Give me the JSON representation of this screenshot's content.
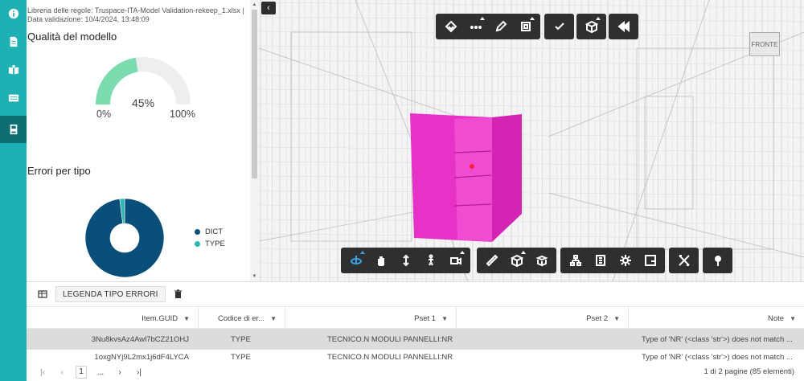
{
  "rail": {
    "items": [
      {
        "icon": "info-icon"
      },
      {
        "icon": "document-icon"
      },
      {
        "icon": "book-open-icon"
      },
      {
        "icon": "card-icon"
      },
      {
        "icon": "bookmark-book-icon",
        "active": true
      }
    ]
  },
  "panel": {
    "meta_line1": "Libreria delle regole: Truspace-ITA-Model Validation-rekeep_1.xlsx |",
    "meta_line2": "Data validazione: 10/4/2024, 13:48:09",
    "quality_title": "Qualità del modello",
    "gauge": {
      "value_label": "45%",
      "min_label": "0%",
      "max_label": "100%",
      "value": 45,
      "fill_color": "#7ddbb0",
      "track_color": "#eeeeee"
    },
    "errors_title": "Errori per tipo",
    "legend": [
      {
        "label": "DICT",
        "color": "#0a4f7a"
      },
      {
        "label": "TYPE",
        "color": "#2cb7b3"
      }
    ]
  },
  "chart_data": {
    "type": "pie",
    "title": "Errori per tipo",
    "categories": [
      "DICT",
      "TYPE"
    ],
    "values": [
      98,
      2
    ],
    "colors": [
      "#0a4f7a",
      "#2cb7b3"
    ],
    "legend": "right"
  },
  "viewer": {
    "cube_label": "FRONTE",
    "top_tools": [
      {
        "icon": "layers-diamond-icon"
      },
      {
        "icon": "dots-icon"
      },
      {
        "icon": "pencil-icon"
      },
      {
        "icon": "crop-box-icon"
      },
      {
        "icon": "check-icon"
      },
      {
        "icon": "cube-plus-icon"
      },
      {
        "icon": "rewind-icon"
      }
    ],
    "bottom_tools": [
      {
        "icon": "orbit-icon"
      },
      {
        "icon": "hand-pan-icon"
      },
      {
        "icon": "vertical-move-icon"
      },
      {
        "icon": "person-walk-icon"
      },
      {
        "icon": "camera-icon"
      },
      {
        "icon": "ruler-icon"
      },
      {
        "icon": "section-cube-icon"
      },
      {
        "icon": "explode-cube-icon"
      },
      {
        "icon": "hierarchy-icon"
      },
      {
        "icon": "properties-icon"
      },
      {
        "icon": "gear-icon"
      },
      {
        "icon": "fullscreen-icon"
      },
      {
        "icon": "tools-cross-icon"
      },
      {
        "icon": "pin-icon"
      }
    ]
  },
  "grid": {
    "legenda_label": "LEGENDA TIPO ERRORI",
    "columns": [
      "Item.GUID",
      "Codice di er...",
      "Pset 1",
      "Pset 2",
      "Note"
    ],
    "rows": [
      {
        "guid": "3Nu8kvsAz4Awl7bCZ21OHJ",
        "code": "TYPE",
        "pset1": "TECNICO.N MODULI PANNELLI:NR",
        "pset2": "",
        "note": "Type of 'NR' (<class 'str'>) does not match ..."
      },
      {
        "guid": "1oxgNYj9L2mx1j6dF4LYCA",
        "code": "TYPE",
        "pset1": "TECNICO.N MODULI PANNELLI:NR",
        "pset2": "",
        "note": "Type of 'NR' (<class 'str'>) does not match ..."
      }
    ],
    "pager": {
      "current_page": "1",
      "ellipsis": "...",
      "info": "1 di 2 pagine (85 elementi)"
    }
  }
}
